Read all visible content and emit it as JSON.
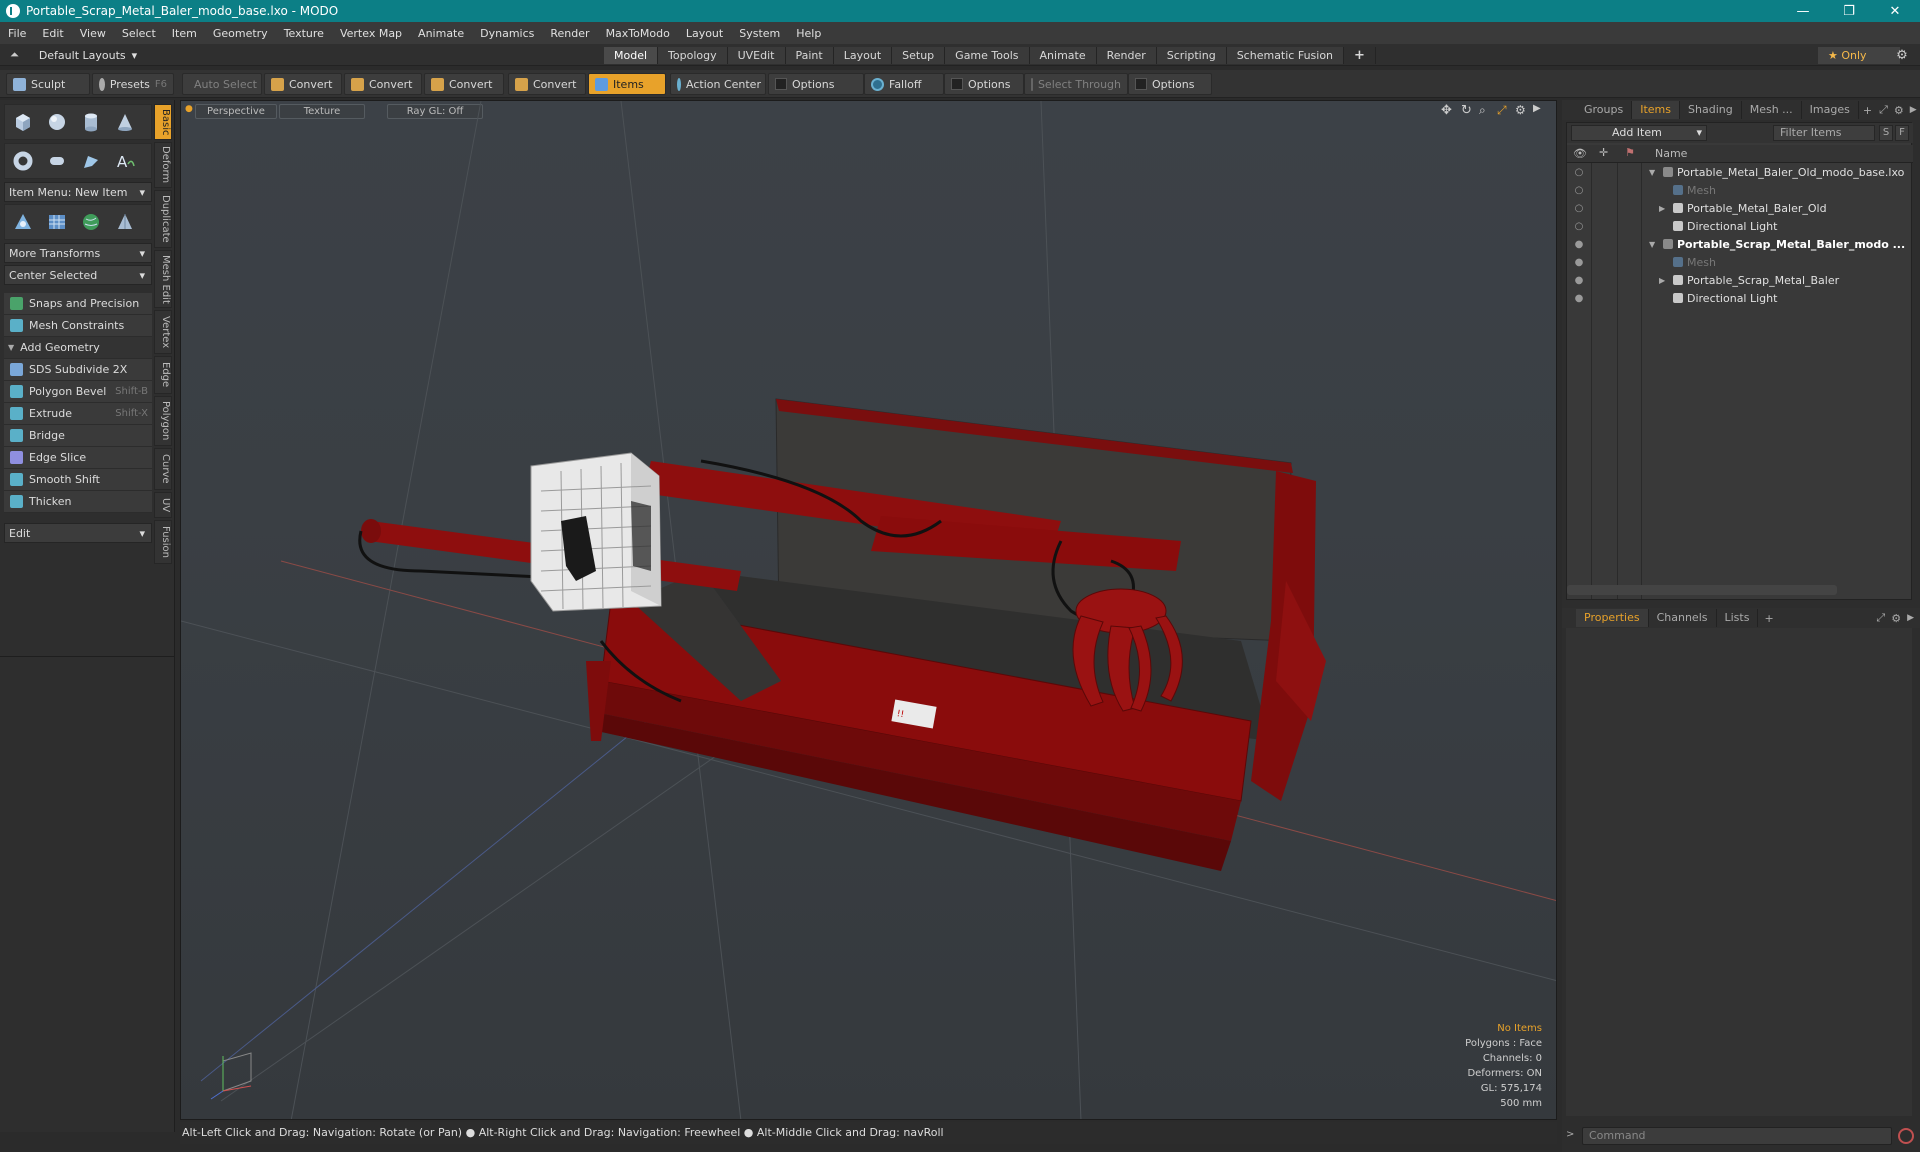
{
  "window": {
    "title": "Portable_Scrap_Metal_Baler_modo_base.lxo - MODO",
    "controls": [
      "—",
      "❐",
      "✕"
    ]
  },
  "menu": [
    "File",
    "Edit",
    "View",
    "Select",
    "Item",
    "Geometry",
    "Texture",
    "Vertex Map",
    "Animate",
    "Dynamics",
    "Render",
    "MaxToModo",
    "Layout",
    "System",
    "Help"
  ],
  "layout": {
    "selector": "Default Layouts",
    "mode_tabs": [
      "Model",
      "Topology",
      "UVEdit",
      "Paint",
      "Layout",
      "Setup",
      "Game Tools",
      "Animate",
      "Render",
      "Scripting",
      "Schematic Fusion"
    ],
    "active_tab": "Model",
    "only_label": "★  Only"
  },
  "toolbar": {
    "sculpt": "Sculpt",
    "presets": "Presets",
    "presets_shortcut": "F6",
    "auto_select": "Auto Select",
    "convert1": "Convert",
    "convert2": "Convert",
    "convert3": "Convert",
    "convert4": "Convert",
    "items": "Items",
    "action_center": "Action Center",
    "options1": "Options",
    "falloff": "Falloff",
    "options2": "Options",
    "select_through": "Select Through",
    "options3": "Options"
  },
  "left_panel": {
    "item_menu": "Item Menu: New Item",
    "more_transforms": "More Transforms",
    "center_selected": "Center Selected",
    "snaps": "Snaps and Precision",
    "mesh_constraints": "Mesh Constraints",
    "add_geometry": "Add Geometry",
    "tools": [
      {
        "label": "SDS Subdivide 2X",
        "shortcut": "",
        "color": "#7aa7d8"
      },
      {
        "label": "Polygon Bevel",
        "shortcut": "Shift-B",
        "color": "#5ab0c8"
      },
      {
        "label": "Extrude",
        "shortcut": "Shift-X",
        "color": "#5ab0c8"
      },
      {
        "label": "Bridge",
        "shortcut": "",
        "color": "#5ab0c8"
      },
      {
        "label": "Edge Slice",
        "shortcut": "",
        "color": "#8f8fe0"
      },
      {
        "label": "Smooth Shift",
        "shortcut": "",
        "color": "#5ab0c8"
      },
      {
        "label": "Thicken",
        "shortcut": "",
        "color": "#5ab0c8"
      }
    ],
    "edit": "Edit",
    "side_tabs": [
      "Basic",
      "Deform",
      "Duplicate",
      "Mesh Edit",
      "Vertex",
      "Edge",
      "Polygon",
      "Curve",
      "UV",
      "Fusion"
    ]
  },
  "viewport": {
    "view": "Perspective",
    "shading": "Texture",
    "raygl": "Ray GL: Off",
    "stats": {
      "items": "No Items",
      "polygons": "Polygons : Face",
      "channels": "Channels: 0",
      "deformers": "Deformers: ON",
      "gl": "GL: 575,174",
      "scale": "500 mm"
    },
    "plate_text": "!!"
  },
  "status_bar": "Alt-Left Click and Drag: Navigation: Rotate (or Pan) ● Alt-Right Click and Drag: Navigation: Freewheel ● Alt-Middle Click and Drag: navRoll",
  "right_panel": {
    "tabs": [
      "Groups",
      "Items",
      "Shading",
      "Mesh ...",
      "Images"
    ],
    "active_tab": "Items",
    "add_item": "Add Item",
    "filter_items": "Filter Items",
    "filter_s": "S",
    "filter_f": "F",
    "col_name": "Name",
    "tree": [
      {
        "label": "Portable_Metal_Baler_Old_modo_base.lxo",
        "depth": 0,
        "arrow": "▼",
        "dim": false,
        "bold": false,
        "eye": "○"
      },
      {
        "label": "Mesh",
        "depth": 1,
        "arrow": "",
        "dim": true,
        "bold": false,
        "eye": "○"
      },
      {
        "label": "Portable_Metal_Baler_Old",
        "depth": 1,
        "arrow": "▶",
        "dim": false,
        "bold": false,
        "eye": "○"
      },
      {
        "label": "Directional Light",
        "depth": 1,
        "arrow": "",
        "dim": false,
        "bold": false,
        "eye": "○"
      },
      {
        "label": "Portable_Scrap_Metal_Baler_modo ...",
        "depth": 0,
        "arrow": "▼",
        "dim": false,
        "bold": true,
        "eye": "●"
      },
      {
        "label": "Mesh",
        "depth": 1,
        "arrow": "",
        "dim": true,
        "bold": false,
        "eye": "●"
      },
      {
        "label": "Portable_Scrap_Metal_Baler",
        "depth": 1,
        "arrow": "▶",
        "dim": false,
        "bold": false,
        "eye": "●"
      },
      {
        "label": "Directional Light",
        "depth": 1,
        "arrow": "",
        "dim": false,
        "bold": false,
        "eye": "●"
      }
    ],
    "prop_tabs": [
      "Properties",
      "Channels",
      "Lists"
    ],
    "prop_active": "Properties",
    "command_placeholder": "Command"
  },
  "colors": {
    "accent": "#e8a22a",
    "title": "#0c7f86",
    "machine": "#8a0c0c"
  }
}
